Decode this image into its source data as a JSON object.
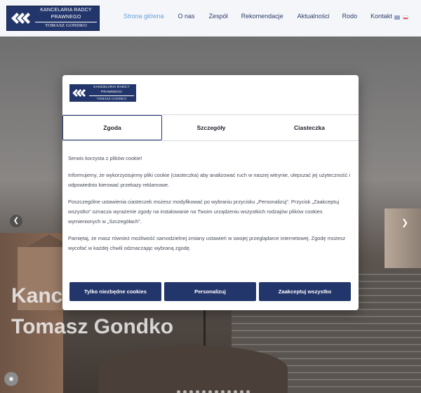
{
  "header": {
    "logo_line1": "KANCELARIA RADCY PRAWNEGO",
    "logo_line2": "TOMASZ GONDKO",
    "nav": [
      "Strona główna",
      "O nas",
      "Zespół",
      "Rekomendacje",
      "Aktualności",
      "Rodo",
      "Kontakt"
    ],
    "active_nav": "Strona główna",
    "accent_color": "#6aa2da",
    "brand_color": "#23366b"
  },
  "hero": {
    "title_line1": "Kancelaria",
    "title_line2": "Tomasz Gondko",
    "cookie_fab_icon": "cookie-icon"
  },
  "modal": {
    "logo_line1": "KANCELARIA RADCY PRAWNEGO",
    "logo_line2": "TOMASZ GONDKO",
    "tabs": [
      "Zgoda",
      "Szczegóły",
      "Ciasteczka"
    ],
    "active_tab": "Zgoda",
    "paragraphs": [
      "Serwis korzysta z plików cookie!",
      "Informujemy, że wykorzystujemy pliki cookie (ciasteczka) aby analizować ruch w naszej witrynie, ulepszać jej użyteczność i odpowiednio kierować przekazy reklamowe.",
      "Poszczególne ustawienia ciasteczek możesz modyfikować po wybraniu przycisku „Personalizuj”. Przycisk „Zaakceptuj wszystko” oznacza wyrażenie zgody na instalowanie na Twoim urządzeniu wszystkich rodzajów plików cookies wymienionych w „Szczegółach”.",
      "Pamiętaj, że masz również możliwość samodzielnej zmiany ustawień w swojej przeglądarce internetowej. Zgodę możesz wycofać w każdej chwili odznaczając wybraną zgodę."
    ],
    "buttons": {
      "necessary": "Tylko niezbędne cookies",
      "personalize": "Personalizuj",
      "accept_all": "Zaakceptuj wszystko"
    }
  }
}
